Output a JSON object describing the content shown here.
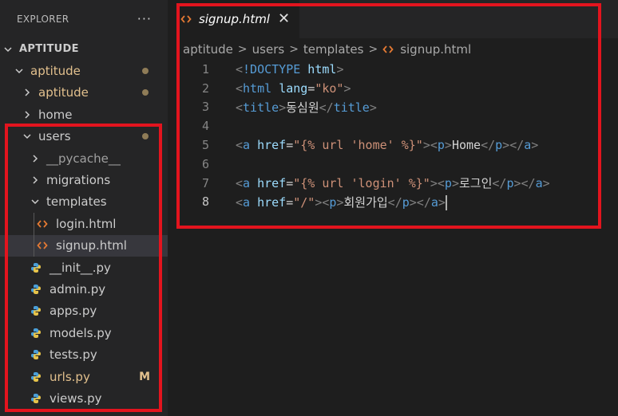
{
  "explorer": {
    "title": "EXPLORER",
    "more_label": "···",
    "section": "APTITUDE",
    "items": [
      {
        "label": "aptitude",
        "kind": "folder",
        "open": true,
        "depth": 1,
        "modified": "dot"
      },
      {
        "label": "aptitude",
        "kind": "folder",
        "open": false,
        "depth": 2,
        "modified": "dot"
      },
      {
        "label": "home",
        "kind": "folder",
        "open": false,
        "depth": 2
      },
      {
        "label": "users",
        "kind": "folder",
        "open": true,
        "depth": 2,
        "modified": "dot"
      },
      {
        "label": "__pycache__",
        "kind": "folder",
        "open": false,
        "depth": 3
      },
      {
        "label": "migrations",
        "kind": "folder",
        "open": false,
        "depth": 3
      },
      {
        "label": "templates",
        "kind": "folder",
        "open": true,
        "depth": 3
      },
      {
        "label": "login.html",
        "kind": "html",
        "depth": 4
      },
      {
        "label": "signup.html",
        "kind": "html",
        "depth": 4,
        "selected": true
      },
      {
        "label": "__init__.py",
        "kind": "python",
        "depth": 3
      },
      {
        "label": "admin.py",
        "kind": "python",
        "depth": 3
      },
      {
        "label": "apps.py",
        "kind": "python",
        "depth": 3
      },
      {
        "label": "models.py",
        "kind": "python",
        "depth": 3
      },
      {
        "label": "tests.py",
        "kind": "python",
        "depth": 3
      },
      {
        "label": "urls.py",
        "kind": "python",
        "depth": 3,
        "modified": "M"
      },
      {
        "label": "views.py",
        "kind": "python",
        "depth": 3
      }
    ]
  },
  "editor": {
    "tab": {
      "label": "signup.html",
      "close_label": "✕"
    },
    "breadcrumb": [
      "aptitude",
      "users",
      "templates",
      "signup.html"
    ],
    "active_line": 8,
    "lines": [
      "<!DOCTYPE html>",
      "<html lang=\"ko\">",
      "<title>동심원</title>",
      "",
      "<a href=\"{% url 'home' %}\"><p>Home</p></a>",
      "",
      "<a href=\"{% url 'login' %}\"><p>로그인</p></a>",
      "<a href=\"/\"><p>회원가입</p></a>"
    ]
  },
  "colors": {
    "highlight_box": "#e3141e",
    "modified": "#e2c08d",
    "html_icon": "#e37933",
    "python_icon": "#4a9fd8",
    "tag": "#569cd6",
    "attribute": "#9cdcfe",
    "string": "#ce9178"
  }
}
